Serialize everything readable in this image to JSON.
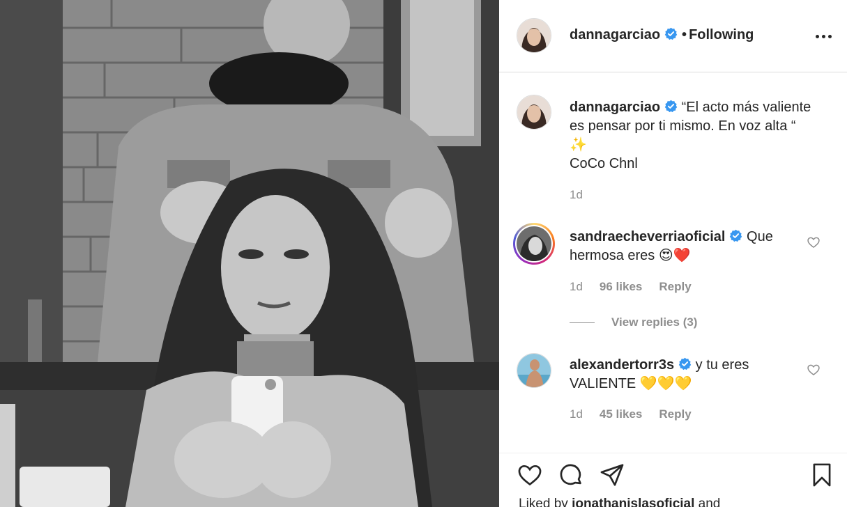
{
  "post": {
    "photo_alt": "Black and white photo: a man styling the hair of a woman taking a mirror selfie with a phone",
    "author": {
      "username": "dannagarciao",
      "verified": true,
      "follow_state": "Following",
      "separator": "•"
    }
  },
  "caption": {
    "username": "dannagarciao",
    "text_line1": "“El acto más valiente",
    "text_line2": "es pensar por ti mismo. En voz alta “",
    "emoji": "✨",
    "text_line4": "CoCo Chnl",
    "time": "1d"
  },
  "comments": [
    {
      "username": "sandraecheverriaoficial",
      "verified": true,
      "text_line1": "Que",
      "text_line2": "hermosa eres",
      "emoji": "😍❤️",
      "time": "1d",
      "likes": "96 likes",
      "reply_label": "Reply",
      "view_replies": "View replies (3)"
    },
    {
      "username": "alexandertorr3s",
      "verified": true,
      "text_line1": "y tu eres",
      "text_line2": "VALIENTE",
      "emoji": "💛💛💛",
      "time": "1d",
      "likes": "45 likes",
      "reply_label": "Reply"
    }
  ],
  "liked_by": {
    "prefix": "Liked by",
    "username": "jonathanislasoficial",
    "suffix": "and"
  },
  "icons": {
    "like": "heart-icon",
    "comment": "comment-bubble-icon",
    "share": "paper-plane-icon",
    "save": "bookmark-icon",
    "more": "more-options-icon",
    "verified": "verified-badge-icon",
    "verified_color": "#3897f0"
  }
}
